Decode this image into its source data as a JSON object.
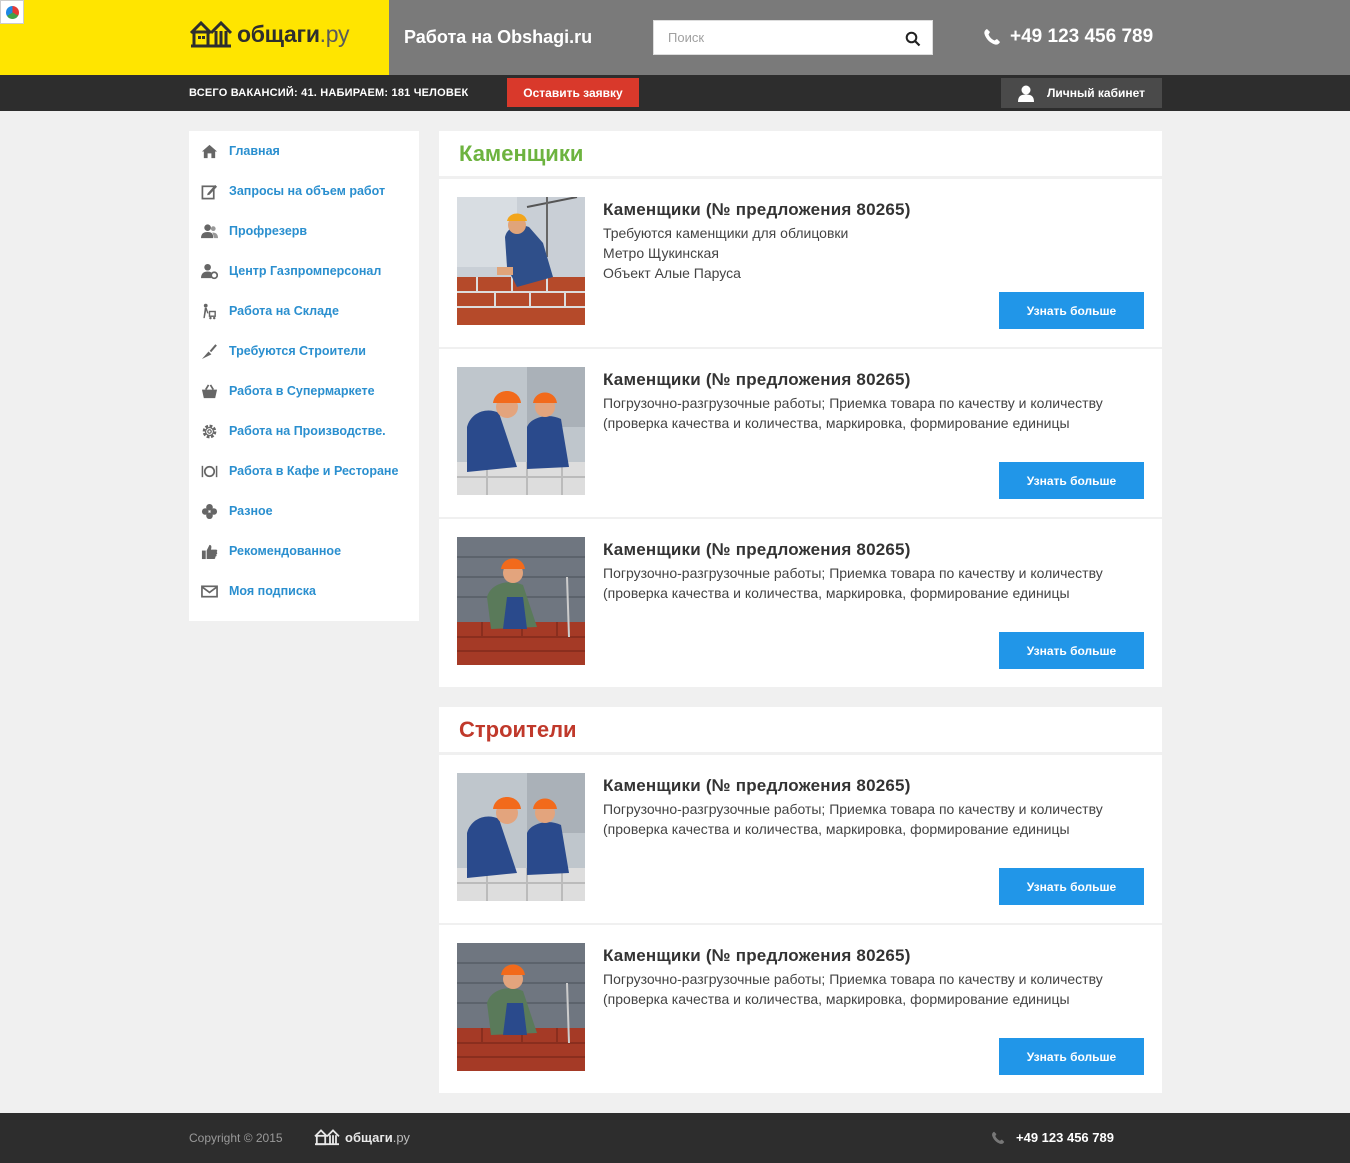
{
  "header": {
    "logo_text": "общаги",
    "logo_tld": ".ру",
    "site_title": "Работа на Obshagi.ru",
    "search_placeholder": "Поиск",
    "search_value": "",
    "phone": "+49 123 456 789",
    "colors": {
      "yellow": "#ffe500",
      "gray": "#7a7a7a"
    }
  },
  "strip": {
    "counts": "Всего вакансий: 41. Набираем: 181 человек",
    "apply_label": "Оставить заявку",
    "cabinet_label": "Личный кабинет",
    "colors": {
      "apply": "#d9392b"
    }
  },
  "sidebar": {
    "items": [
      {
        "label": "Главная",
        "icon": "home-icon"
      },
      {
        "label": "Запросы на объем работ",
        "icon": "edit-icon"
      },
      {
        "label": "Профрезерв",
        "icon": "users-icon"
      },
      {
        "label": "Центр Газпромперсонал",
        "icon": "person-gear-icon"
      },
      {
        "label": "Работа на Складе",
        "icon": "forklift-icon"
      },
      {
        "label": "Требуются Строители",
        "icon": "trowel-icon"
      },
      {
        "label": "Работа в Супермаркете",
        "icon": "basket-icon"
      },
      {
        "label": "Работа на Производстве.",
        "icon": "cog-icon"
      },
      {
        "label": "Работа в Кафе и Ресторане",
        "icon": "plate-icon"
      },
      {
        "label": "Разное",
        "icon": "clover-icon"
      },
      {
        "label": "Рекомендованное",
        "icon": "thumbs-up-icon"
      },
      {
        "label": "Моя подписка",
        "icon": "envelope-icon"
      }
    ],
    "link_color": "#2a8fcf"
  },
  "sections": [
    {
      "title": "Каменщики",
      "color": "#6db33f",
      "cards": [
        {
          "title": "Каменщики (№ предложения 80265)",
          "lines": [
            "Требуются каменщики для облицовки",
            "Метро Щукинская",
            "Объект Алые Паруса"
          ],
          "button": "Узнать больше"
        },
        {
          "title": "Каменщики (№ предложения 80265)",
          "lines": [
            "Погрузочно-разгрузочные работы; Приемка товара по качеству и количеству (проверка качества и количества, маркировка, формирование единицы"
          ],
          "button": "Узнать больше"
        },
        {
          "title": "Каменщики (№ предложения 80265)",
          "lines": [
            "Погрузочно-разгрузочные работы; Приемка товара по качеству и количеству (проверка качества и количества, маркировка, формирование единицы"
          ],
          "button": "Узнать больше"
        }
      ]
    },
    {
      "title": "Строители",
      "color": "#c0392b",
      "cards": [
        {
          "title": "Каменщики (№ предложения 80265)",
          "lines": [
            "Погрузочно-разгрузочные работы; Приемка товара по качеству и количеству (проверка качества и количества, маркировка, формирование единицы"
          ],
          "button": "Узнать больше"
        },
        {
          "title": "Каменщики (№ предложения 80265)",
          "lines": [
            "Погрузочно-разгрузочные работы; Приемка товара по качеству и количеству (проверка качества и количества, маркировка, формирование единицы"
          ],
          "button": "Узнать больше"
        }
      ]
    }
  ],
  "footer": {
    "copyright": "Copyright © 2015",
    "logo_text": "общаги",
    "logo_tld": ".ру",
    "phone": "+49 123 456 789"
  }
}
